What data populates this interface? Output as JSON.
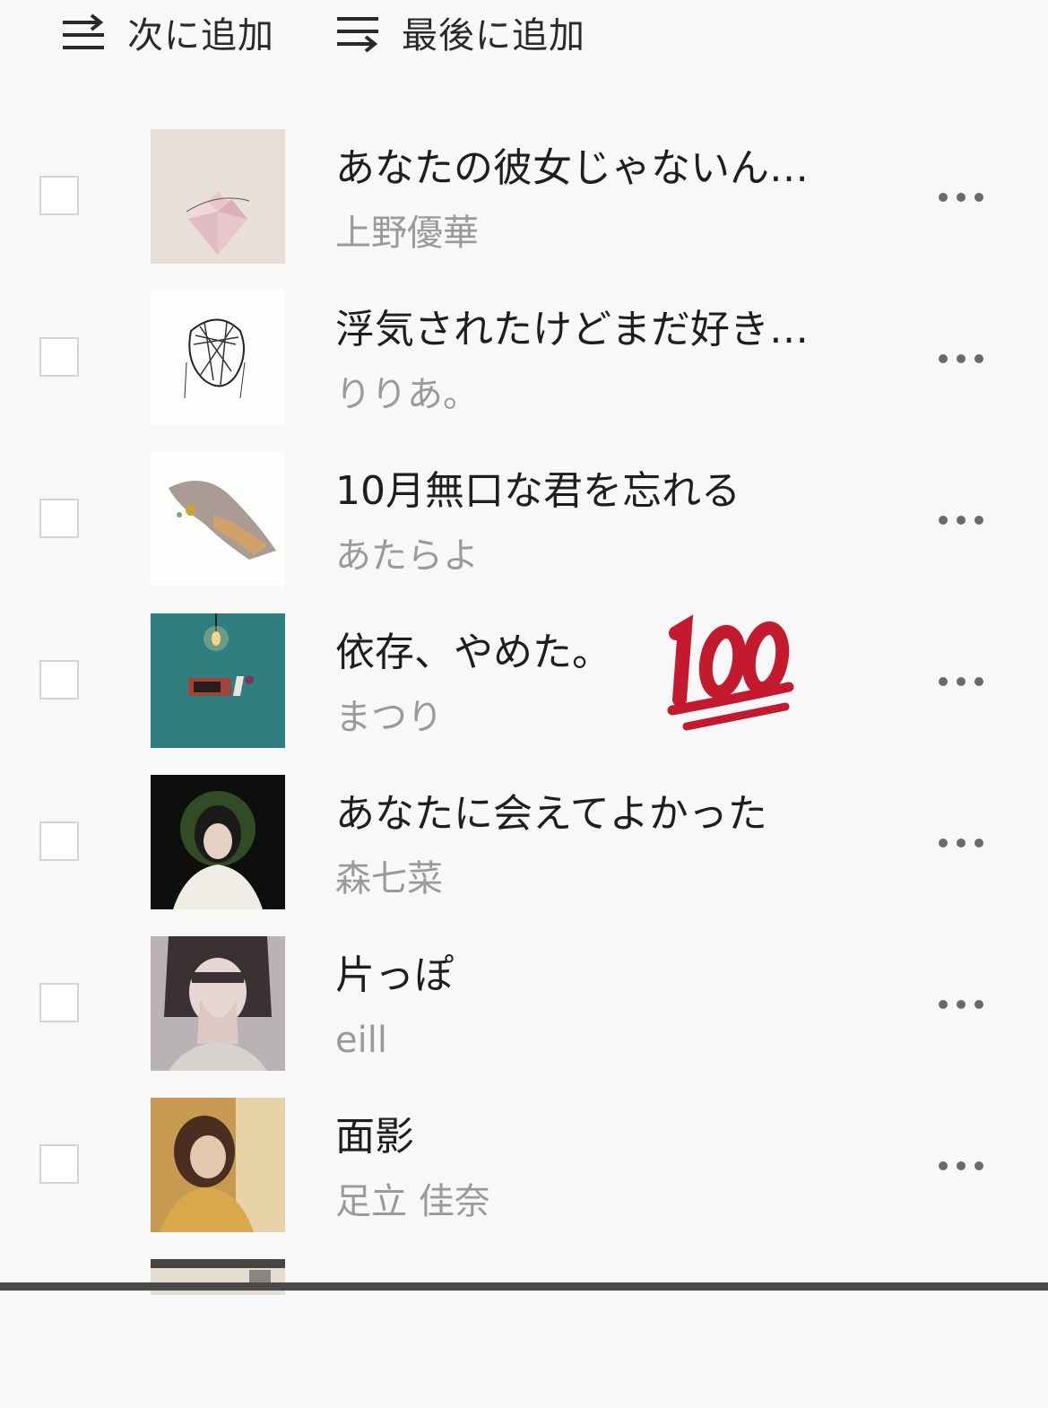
{
  "toolbar": {
    "play_next_label": "次に追加",
    "play_next_icon": "play-next-icon",
    "play_last_label": "最後に追加",
    "play_last_icon": "play-last-icon"
  },
  "tracks": [
    {
      "title": "あなたの彼女じゃないん…",
      "artist": "上野優華",
      "artwork": "origami-heart-artwork"
    },
    {
      "title": "浮気されたけどまだ好き…",
      "artist": "りりあ。",
      "artwork": "scribble-sketch-artwork"
    },
    {
      "title": "10月無口な君を忘れる",
      "artist": "あたらよ",
      "artwork": "watercolor-figure-artwork"
    },
    {
      "title": "依存、やめた。",
      "artist": "まつり",
      "artwork": "lamp-clock-artwork"
    },
    {
      "title": "あなたに会えてよかった",
      "artist": "森七菜",
      "artwork": "portrait-artwork"
    },
    {
      "title": "片っぽ",
      "artist": "eill",
      "artwork": "portrait-artwork"
    },
    {
      "title": "面影",
      "artist": "足立 佳奈",
      "artwork": "portrait-artwork"
    }
  ],
  "overlay": {
    "emoji": "hundred-points-emoji"
  },
  "colors": {
    "background": "#f8f8f8",
    "title_text": "#1e1e1e",
    "artist_text": "#9a9a9a",
    "emoji_red": "#c41a30"
  }
}
